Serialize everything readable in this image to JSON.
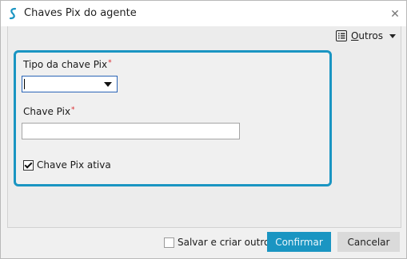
{
  "window": {
    "title": "Chaves Pix do agente",
    "close_symbol": "✕",
    "app_icon": "s-logo-icon"
  },
  "toolbar": {
    "outros_label_underlined": "O",
    "outros_label_rest": "utros",
    "outros_icon": "list-icon"
  },
  "form": {
    "tipo_label": "Tipo da chave Pix",
    "tipo_value": "",
    "chave_label": "Chave Pix",
    "chave_value": "",
    "required_mark": "*",
    "ativa_label": "Chave Pix ativa",
    "ativa_checked": true
  },
  "footer": {
    "salvar_criar_label": "Salvar e criar outro",
    "salvar_criar_checked": false,
    "confirm_label": "Confirmar",
    "cancel_label": "Cancelar"
  },
  "colors": {
    "accent": "#1a95c2",
    "required": "#d8262b"
  }
}
